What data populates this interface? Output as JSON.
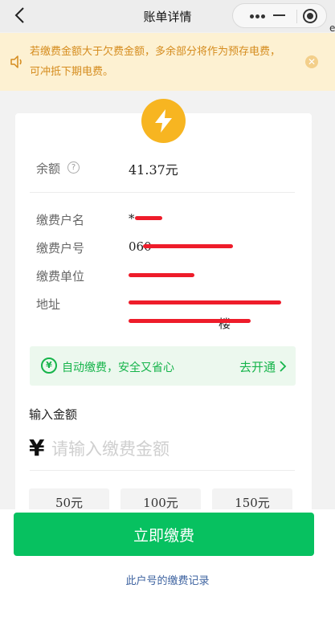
{
  "nav": {
    "title": "账单详情",
    "edge_char": "e"
  },
  "notice": {
    "text": "若缴费金额大于欠费金额，多余部分将作为预存电费，可冲抵下期电费。"
  },
  "account": {
    "balance_label": "余额",
    "balance_value": "41.37元",
    "holder_label": "缴费户名",
    "holder_value": "*",
    "number_label": "缴费户号",
    "number_value": "060",
    "unit_label": "缴费单位",
    "unit_value": "",
    "address_label": "地址",
    "address_line1": "",
    "address_line2": "楼"
  },
  "autopay": {
    "slogan": "自动缴费，安全又省心",
    "action": "去开通"
  },
  "amount": {
    "label": "输入金额",
    "currency": "¥",
    "placeholder": "请输入缴费金额"
  },
  "presets": [
    "50元",
    "100元",
    "150元"
  ],
  "actions": {
    "pay": "立即缴费",
    "records": "此户号的缴费记录"
  },
  "colors": {
    "primary": "#07c160",
    "notice_text": "#d58c1e",
    "notice_bg": "#fdf1d2",
    "bolt": "#f7b521",
    "redaction": "#ee1c2a"
  }
}
